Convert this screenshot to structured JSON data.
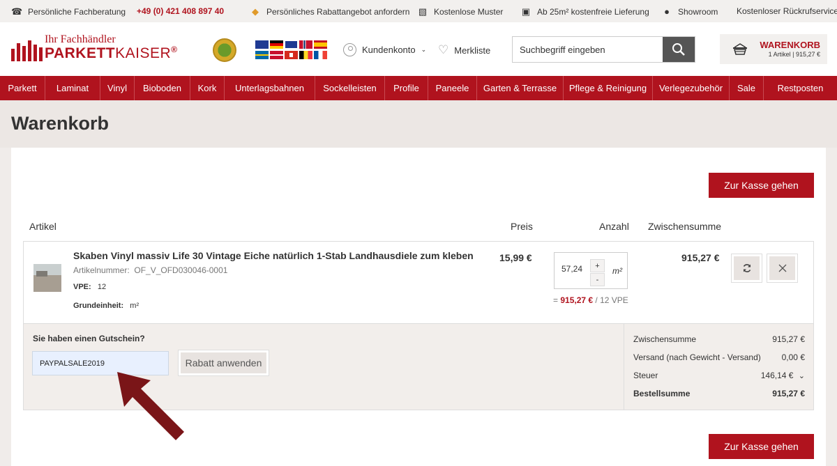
{
  "topbar": {
    "beratung": "Persönliche Fachberatung",
    "phone": "+49 (0) 421 408 897 40",
    "rabatt": "Persönliches Rabattangebot anfordern",
    "muster": "Kostenlose Muster",
    "lieferung": "Ab 25m² kostenfreie Lieferung",
    "showroom": "Showroom",
    "rueckruf": "Kostenloser Rückrufservice"
  },
  "header": {
    "logo_tagline": "Ihr Fachhändler",
    "logo_brand_bold": "PARKETT",
    "logo_brand_light": "KAISER",
    "logo_registered": "®",
    "account_label": "Kundenkonto",
    "wishlist_label": "Merkliste",
    "search_placeholder": "Suchbegriff eingeben",
    "cart_title": "WARENKORB",
    "cart_summary": "1 Artikel  |  915,27 €"
  },
  "nav": {
    "items": [
      "Parkett",
      "Laminat",
      "Vinyl",
      "Bioboden",
      "Kork",
      "Unterlagsbahnen",
      "Sockelleisten",
      "Profile",
      "Paneele",
      "Garten & Terrasse",
      "Pflege & Reinigung",
      "Verlegezubehör",
      "Sale",
      "Restposten"
    ]
  },
  "page": {
    "title": "Warenkorb",
    "checkout_label": "Zur Kasse gehen"
  },
  "table": {
    "col_article": "Artikel",
    "col_price": "Preis",
    "col_qty": "Anzahl",
    "col_subtotal": "Zwischensumme"
  },
  "item": {
    "name": "Skaben Vinyl massiv Life 30 Vintage Eiche natürlich 1-Stab Landhausdiele zum kleben",
    "sku_label": "Artikelnummer:",
    "sku": "OF_V_OFD030046-0001",
    "vpe_label": "VPE:",
    "vpe": "12",
    "unit_label": "Grundeinheit:",
    "unit": "m²",
    "price": "15,99 €",
    "quantity": "57,24",
    "qty_unit": "m²",
    "plus": "+",
    "minus": "-",
    "vpe_prefix": "=",
    "vpe_total": "915,27 €",
    "vpe_suffix": "/ 12 VPE",
    "subtotal": "915,27 €"
  },
  "coupon": {
    "question": "Sie haben einen Gutschein?",
    "code": "PAYPALSALE2019",
    "apply_label": "Rabatt anwenden"
  },
  "summary": {
    "rows": [
      {
        "label": "Zwischensumme",
        "value": "915,27 €"
      },
      {
        "label": "Versand (nach Gewicht - Versand)",
        "value": "0,00 €"
      },
      {
        "label": "Steuer",
        "value": "146,14 €"
      },
      {
        "label": "Bestellsumme",
        "value": "915,27 €"
      }
    ]
  },
  "colors": {
    "brand_red": "#b0131e",
    "annotation_arrow": "#7a1518"
  }
}
